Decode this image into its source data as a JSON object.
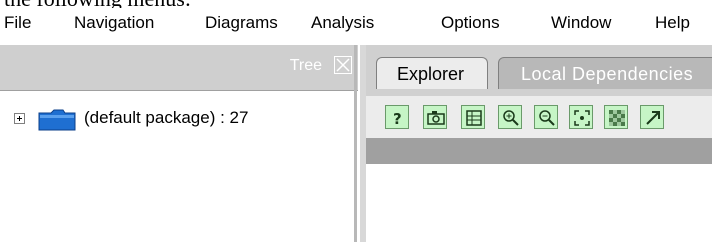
{
  "document_text": "the following menus:",
  "menubar": {
    "items": [
      {
        "label": "File"
      },
      {
        "label": "Navigation"
      },
      {
        "label": "Diagrams"
      },
      {
        "label": "Analysis"
      },
      {
        "label": "Options"
      },
      {
        "label": "Window"
      },
      {
        "label": "Help"
      }
    ]
  },
  "tree_panel": {
    "title": "Tree",
    "close_icon": "close-x-icon",
    "nodes": [
      {
        "label": "(default package) : 27",
        "icon": "folder-icon",
        "expanded": false
      }
    ]
  },
  "explorer_panel": {
    "tabs": [
      {
        "label": "Explorer",
        "active": true
      },
      {
        "label": "Local Dependencies",
        "active": false
      }
    ],
    "toolbar": [
      {
        "icon": "help-icon"
      },
      {
        "icon": "camera-icon"
      },
      {
        "icon": "table-icon"
      },
      {
        "icon": "zoom-in-icon"
      },
      {
        "icon": "zoom-out-icon"
      },
      {
        "icon": "fit-to-window-icon"
      },
      {
        "icon": "pattern-icon"
      },
      {
        "icon": "arrow-icon"
      }
    ]
  },
  "colors": {
    "toolbar_button_bg": "#c6f5c6",
    "folder_blue": "#1f6fd1",
    "panel_header": "#cfcfcf",
    "grey_band": "#a0a0a0"
  }
}
